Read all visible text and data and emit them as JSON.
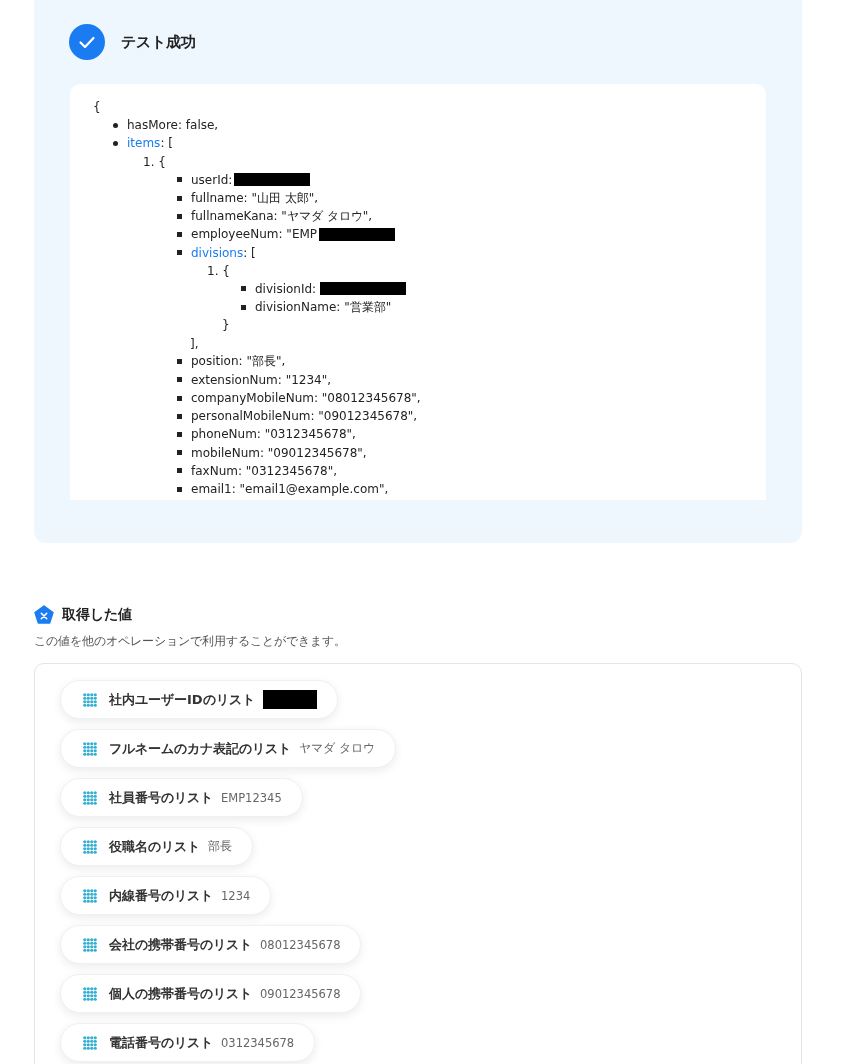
{
  "result": {
    "title": "テスト成功",
    "code": {
      "open": "{",
      "entries": [
        {
          "key": "hasMore",
          "value": ": false,",
          "expandable": false
        },
        {
          "key": "items",
          "value": ": [",
          "expandable": true,
          "objects": [
            {
              "number": "1.",
              "open": "{",
              "fields": [
                {
                  "text": "userId:",
                  "redacted": true,
                  "expandable": false
                },
                {
                  "text": "fullname: \"山田 太郎\",",
                  "redacted": false,
                  "expandable": false
                },
                {
                  "text": "fullnameKana: \"ヤマダ タロウ\",",
                  "redacted": false,
                  "expandable": false
                },
                {
                  "text": "employeeNum: \"EMP",
                  "redacted": true,
                  "expandable": false
                },
                {
                  "text": "divisions",
                  "suffix": ": [",
                  "redacted": false,
                  "expandable": true,
                  "objects": [
                    {
                      "number": "1.",
                      "open": "{",
                      "close": "}",
                      "fields": [
                        {
                          "text": "divisionId:",
                          "redacted": true
                        },
                        {
                          "text": "divisionName: \"営業部\"",
                          "redacted": false
                        }
                      ]
                    }
                  ],
                  "close": "],"
                },
                {
                  "text": "position: \"部長\",",
                  "redacted": false,
                  "expandable": false
                },
                {
                  "text": "extensionNum: \"1234\",",
                  "redacted": false,
                  "expandable": false
                },
                {
                  "text": "companyMobileNum: \"08012345678\",",
                  "redacted": false,
                  "expandable": false
                },
                {
                  "text": "personalMobileNum: \"09012345678\",",
                  "redacted": false,
                  "expandable": false
                },
                {
                  "text": "phoneNum: \"0312345678\",",
                  "redacted": false,
                  "expandable": false
                },
                {
                  "text": "mobileNum: \"09012345678\",",
                  "redacted": false,
                  "expandable": false
                },
                {
                  "text": "faxNum: \"0312345678\",",
                  "redacted": false,
                  "expandable": false
                },
                {
                  "text": "email1: \"email1@example.com\",",
                  "redacted": false,
                  "expandable": false
                }
              ]
            }
          ]
        }
      ]
    }
  },
  "values": {
    "title": "取得した値",
    "description": "この値を他のオペレーションで利用することができます。",
    "items": [
      {
        "label": "社内ユーザーIDのリスト",
        "redacted": true
      },
      {
        "label": "フルネームのカナ表記のリスト",
        "value": "ヤマダ タロウ",
        "redacted": false
      },
      {
        "label": "社員番号のリスト",
        "value": "EMP12345",
        "redacted": false
      },
      {
        "label": "役職名のリスト",
        "value": "部長",
        "redacted": false
      },
      {
        "label": "内線番号のリスト",
        "value": "1234",
        "redacted": false
      },
      {
        "label": "会社の携帯番号のリスト",
        "value": "08012345678",
        "redacted": false
      },
      {
        "label": "個人の携帯番号のリスト",
        "value": "09012345678",
        "redacted": false
      },
      {
        "label": "電話番号のリスト",
        "value": "0312345678",
        "redacted": false
      }
    ]
  }
}
